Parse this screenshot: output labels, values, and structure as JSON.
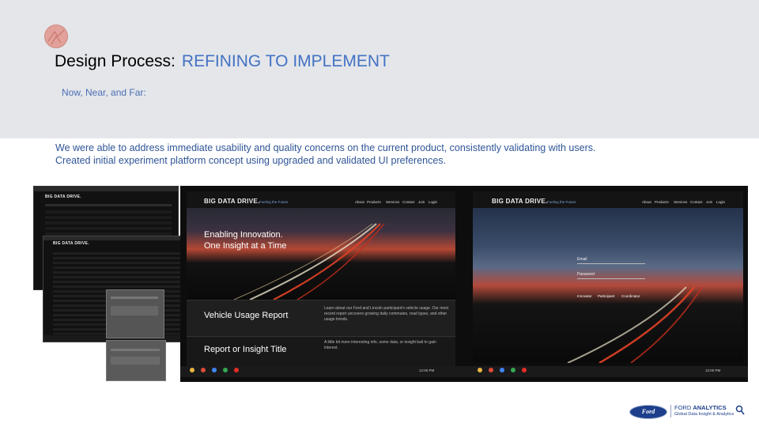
{
  "slide": {
    "title_prefix": "Design Process:",
    "title_accent": "REFINING TO IMPLEMENT",
    "subtitle": "Now, Near, and Far:",
    "body_lines": [
      "We were able to address immediate usability and quality concerns on the current product, consistently validating with users.",
      "Created initial experiment platform concept using upgraded and validated UI preferences."
    ]
  },
  "app": {
    "brand": "BIG DATA DRIVE.",
    "tagline": "Fueling the Future",
    "nav": [
      "About",
      "Products",
      "Services",
      "Contact",
      "Join",
      "Login"
    ],
    "hero_line1": "Enabling Innovation.",
    "hero_line2": "One Insight at a Time",
    "card1_title": "Vehicle Usage Report",
    "card1_text": "Learn about our Ford and Lincoln participant's vehicle usage. Our most recent report uncovers growing daily commutes, road types, and other usage trends.",
    "card2_title": "Report or Insight Title",
    "card2_text": "A little bit more interesting info, some data, or insight bait to gain interest.",
    "email_label": "Email",
    "password_label": "Password",
    "roles": [
      "Innovator",
      "Participant",
      "Coordinator"
    ],
    "time": "12:00 PM"
  },
  "footer": {
    "logo_text": "Ford",
    "name_prefix": "FORD",
    "name_bold": "ANALYTICS",
    "sub": "Global Data Insight & Analytics"
  },
  "colors": {
    "accent": "#4472c4",
    "body_text": "#2f5597",
    "band": "#e4e6ea"
  }
}
